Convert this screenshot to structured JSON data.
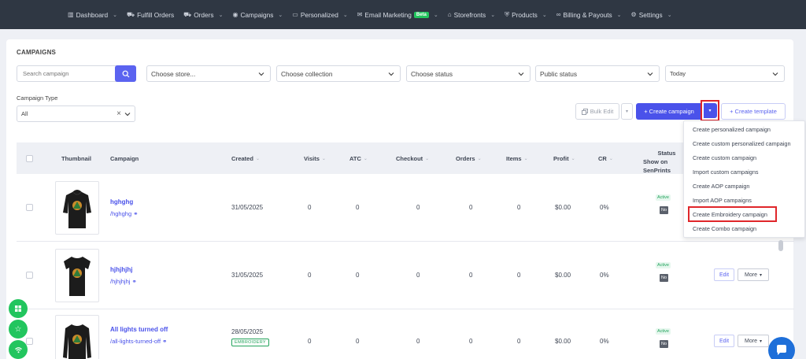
{
  "nav": {
    "items": [
      {
        "label": "Dashboard",
        "icon": "bar-chart-icon",
        "dropdown": true
      },
      {
        "label": "Fulfill Orders",
        "icon": "cart-icon",
        "dropdown": false
      },
      {
        "label": "Orders",
        "icon": "cart-icon",
        "dropdown": true
      },
      {
        "label": "Campaigns",
        "icon": "target-icon",
        "dropdown": true
      },
      {
        "label": "Personalized",
        "icon": "monitor-icon",
        "dropdown": true
      },
      {
        "label": "Email Marketing",
        "icon": "mail-icon",
        "dropdown": true,
        "badge": "Beta"
      },
      {
        "label": "Storefronts",
        "icon": "store-icon",
        "dropdown": true
      },
      {
        "label": "Products",
        "icon": "shield-icon",
        "dropdown": true
      },
      {
        "label": "Billing & Payouts",
        "icon": "infinity-icon",
        "dropdown": true
      },
      {
        "label": "Settings",
        "icon": "gear-icon",
        "dropdown": true
      }
    ]
  },
  "page": {
    "title": "CAMPAIGNS"
  },
  "filters": {
    "search_placeholder": "Search campaign",
    "store": "Choose store...",
    "collection": "Choose collection",
    "status": "Choose status",
    "public_status": "Public status",
    "date": "Today",
    "campaign_type_label": "Campaign Type",
    "campaign_type_value": "All"
  },
  "toolbar": {
    "bulk_edit": "Bulk Edit",
    "create_campaign": "+ Create campaign",
    "create_template": "+ Create template"
  },
  "dropdown_menu": {
    "items": [
      "Create personalized campaign",
      "Create custom personalized campaign",
      "Create custom campaign",
      "Import custom campaigns",
      "Create AOP campaign",
      "Import AOP campaigns",
      "Create Embroidery campaign",
      "Create Combo campaign"
    ],
    "highlighted": "Create Embroidery campaign"
  },
  "table": {
    "headers": {
      "thumbnail": "Thumbnail",
      "campaign": "Campaign",
      "created": "Created",
      "visits": "Visits",
      "atc": "ATC",
      "checkout": "Checkout",
      "orders": "Orders",
      "items": "Items",
      "profit": "Profit",
      "cr": "CR",
      "status_line1": "Status",
      "status_line2": "Show on SenPrints"
    },
    "rows": [
      {
        "name": "hghghg",
        "slug": "/hghghg",
        "created": "31/05/2025",
        "tag": "",
        "visits": "0",
        "atc": "0",
        "checkout": "0",
        "orders": "0",
        "items": "0",
        "profit": "$0.00",
        "cr": "0%",
        "status": "Active",
        "show": "No",
        "shirt_color": "#1c1c1c",
        "shirt_type": "hoodie"
      },
      {
        "name": "hjhjhjhj",
        "slug": "/hjhjhjhj",
        "created": "31/05/2025",
        "tag": "",
        "visits": "0",
        "atc": "0",
        "checkout": "0",
        "orders": "0",
        "items": "0",
        "profit": "$0.00",
        "cr": "0%",
        "status": "Active",
        "show": "No",
        "shirt_color": "#1c1c1c",
        "shirt_type": "tee"
      },
      {
        "name": "All lights turned off",
        "slug": "/all-lights-turned-off",
        "created": "28/05/2025",
        "tag": "EMBROIDERY",
        "visits": "0",
        "atc": "0",
        "checkout": "0",
        "orders": "0",
        "items": "0",
        "profit": "$0.00",
        "cr": "0%",
        "status": "Active",
        "show": "No",
        "shirt_color": "#1c1c1c",
        "shirt_type": "sweatshirt"
      }
    ],
    "row_actions": {
      "edit": "Edit",
      "more": "More"
    }
  },
  "colors": {
    "nav_bg": "#2f3743",
    "primary": "#4a52ea",
    "highlight_border": "#e0262a",
    "active_green": "#22a35b",
    "fab_green": "#22c55e",
    "chat_blue": "#1e6fd9"
  }
}
